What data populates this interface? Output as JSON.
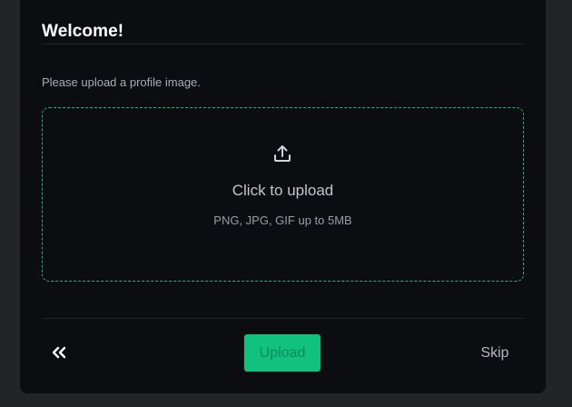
{
  "modal": {
    "title": "Welcome!",
    "instruction": "Please upload a profile image."
  },
  "dropzone": {
    "icon": "upload-icon",
    "primary_text": "Click to upload",
    "secondary_text": "PNG, JPG, GIF up to 5MB",
    "border_color": "#27b574"
  },
  "footer": {
    "back_icon": "double-chevron-left-icon",
    "upload_label": "Upload",
    "skip_label": "Skip",
    "accent_color": "#10c27e"
  }
}
